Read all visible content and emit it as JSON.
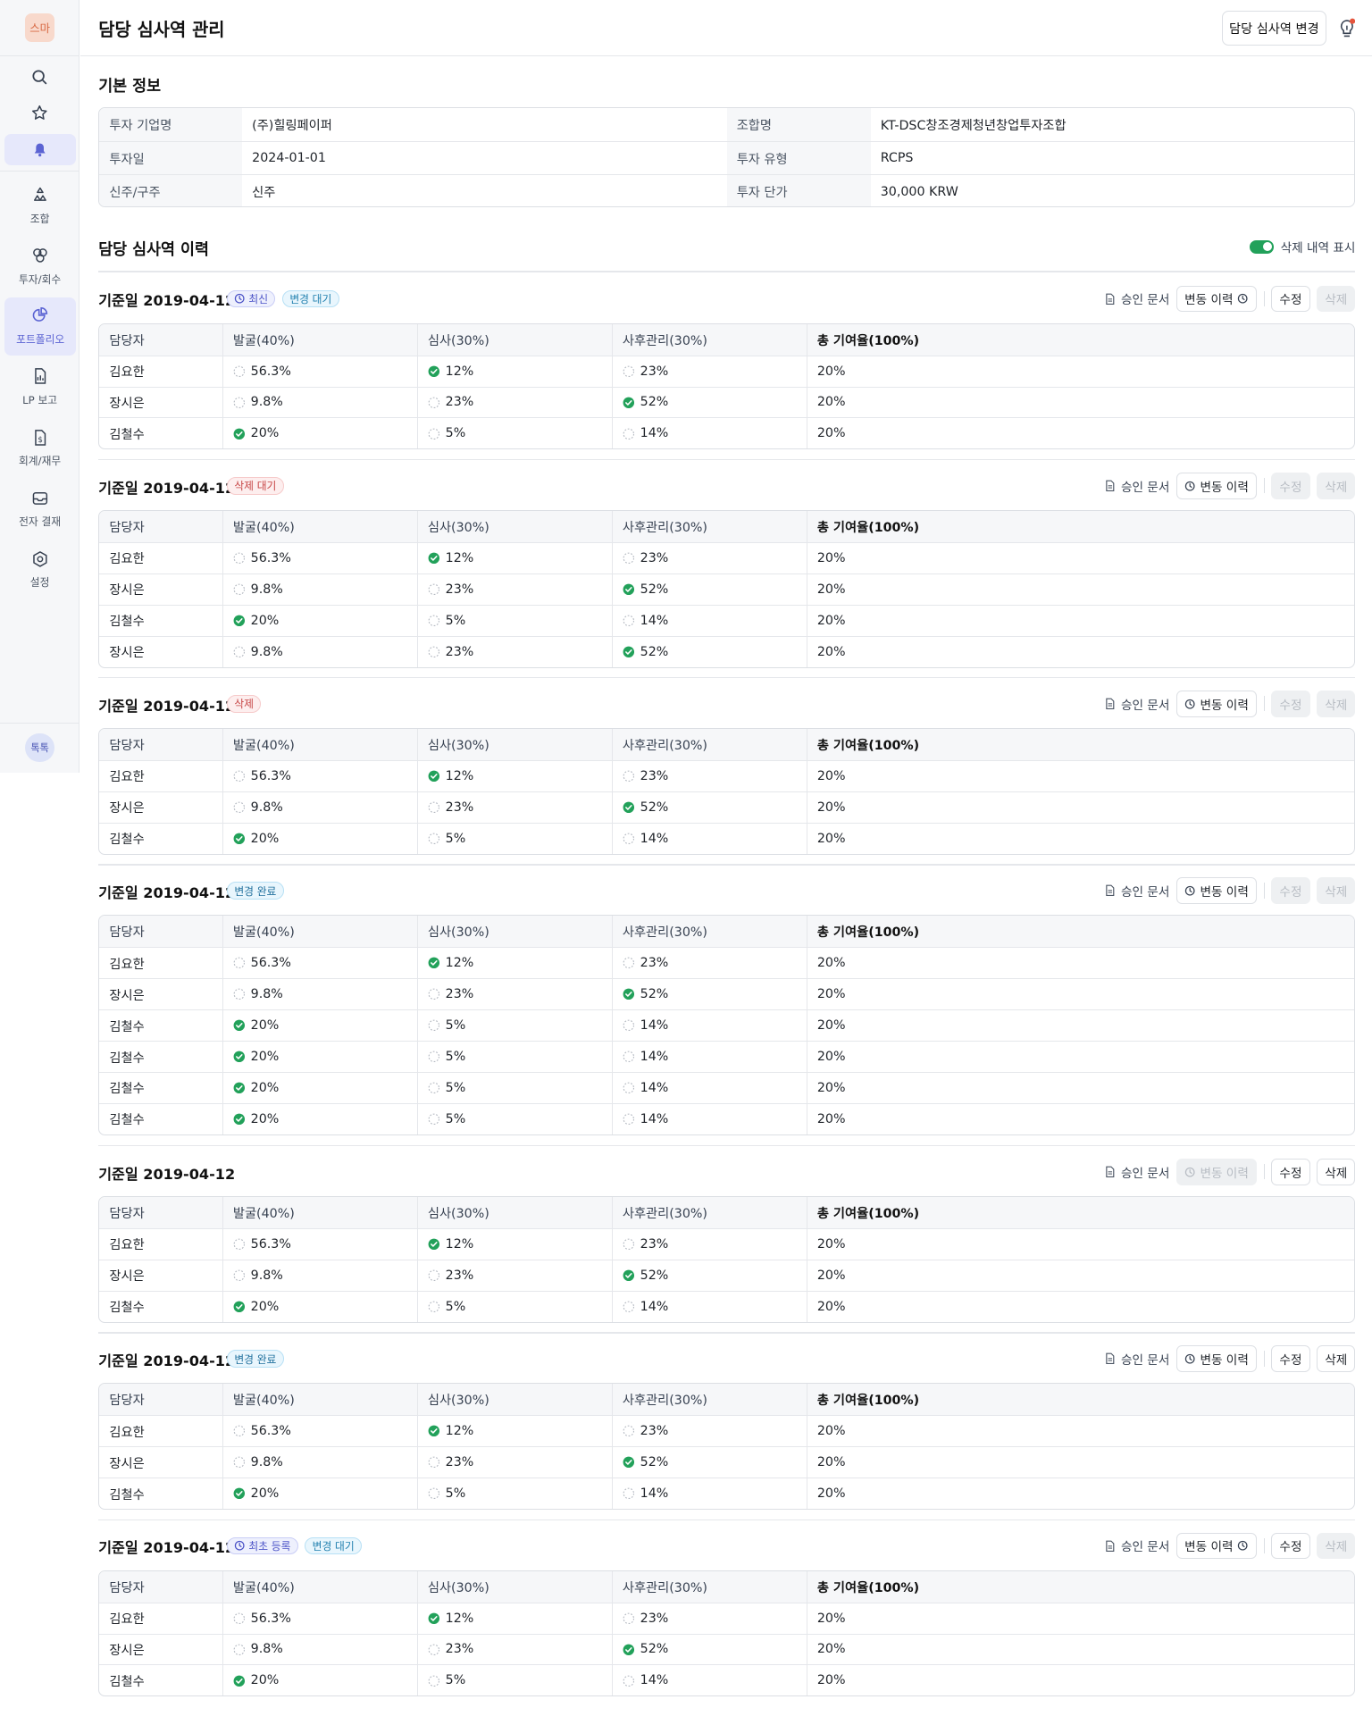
{
  "sidebar": {
    "logo": "스마",
    "talk": "톡톡",
    "items": [
      {
        "label": "조합"
      },
      {
        "label": "투자/회수"
      },
      {
        "label": "포트폴리오"
      },
      {
        "label": "LP 보고"
      },
      {
        "label": "회계/재무"
      },
      {
        "label": "전자 결재"
      },
      {
        "label": "설정"
      }
    ]
  },
  "header": {
    "title": "담당 심사역 관리",
    "change_button": "담당 심사역 변경"
  },
  "basic_info": {
    "title": "기본 정보",
    "rows": [
      [
        {
          "k": "투자 기업명",
          "v": "(주)힐링페이퍼"
        },
        {
          "k": "조합명",
          "v": "KT-DSC창조경제청년창업투자조합"
        }
      ],
      [
        {
          "k": "투자일",
          "v": "2024-01-01"
        },
        {
          "k": "투자 유형",
          "v": "RCPS"
        }
      ],
      [
        {
          "k": "신주/구주",
          "v": "신주"
        },
        {
          "k": "투자 단가",
          "v": "30,000 KRW"
        }
      ]
    ]
  },
  "history": {
    "title": "담당 심사역 이력",
    "toggle_label": "삭제 내역 표시",
    "actions": {
      "doc": "승인 문서",
      "history": "변동 이력",
      "edit": "수정",
      "delete": "삭제"
    },
    "columns": [
      "담당자",
      "발굴(40%)",
      "심사(30%)",
      "사후관리(30%)",
      "총 기여율(100%)"
    ],
    "blocks": [
      {
        "title": "기준일 2019-04-12",
        "badges": [
          {
            "text": "최신",
            "type": "latest",
            "icon": "clock-icon"
          },
          {
            "text": "변경 대기",
            "type": "pending"
          }
        ],
        "rows": [
          [
            "김요한",
            "56.3%",
            "12%",
            "23%",
            "20%"
          ],
          [
            "장시은",
            "9.8%",
            "23%",
            "52%",
            "20%"
          ],
          [
            "김철수",
            "20%",
            "5%",
            "14%",
            "20%"
          ]
        ]
      },
      {
        "title": "기준일 2019-04-12",
        "badges": [
          {
            "text": "삭제 대기",
            "type": "delpending"
          }
        ],
        "rows": [
          [
            "김요한",
            "56.3%",
            "12%",
            "23%",
            "20%"
          ],
          [
            "장시은",
            "9.8%",
            "23%",
            "52%",
            "20%"
          ],
          [
            "김철수",
            "20%",
            "5%",
            "14%",
            "20%"
          ],
          [
            "장시은",
            "9.8%",
            "23%",
            "52%",
            "20%"
          ]
        ]
      },
      {
        "title": "기준일 2019-04-12",
        "badges": [
          {
            "text": "삭제",
            "type": "deleted"
          }
        ],
        "rows": [
          [
            "김요한",
            "56.3%",
            "12%",
            "23%",
            "20%"
          ],
          [
            "장시은",
            "9.8%",
            "23%",
            "52%",
            "20%"
          ],
          [
            "김철수",
            "20%",
            "5%",
            "14%",
            "20%"
          ]
        ]
      },
      {
        "title": "기준일 2019-04-12",
        "badges": [
          {
            "text": "변경 완료",
            "type": "done"
          }
        ],
        "rows": [
          [
            "김요한",
            "56.3%",
            "12%",
            "23%",
            "20%"
          ],
          [
            "장시은",
            "9.8%",
            "23%",
            "52%",
            "20%"
          ],
          [
            "김철수",
            "20%",
            "5%",
            "14%",
            "20%"
          ],
          [
            "김철수",
            "20%",
            "5%",
            "14%",
            "20%"
          ],
          [
            "김철수",
            "20%",
            "5%",
            "14%",
            "20%"
          ],
          [
            "김철수",
            "20%",
            "5%",
            "14%",
            "20%"
          ]
        ]
      },
      {
        "title": "기준일 2019-04-12",
        "badges": [],
        "rows": [
          [
            "김요한",
            "56.3%",
            "12%",
            "23%",
            "20%"
          ],
          [
            "장시은",
            "9.8%",
            "23%",
            "52%",
            "20%"
          ],
          [
            "김철수",
            "20%",
            "5%",
            "14%",
            "20%"
          ]
        ]
      },
      {
        "title": "기준일 2019-04-12",
        "badges": [
          {
            "text": "변경 완료",
            "type": "done"
          }
        ],
        "rows": [
          [
            "김요한",
            "56.3%",
            "12%",
            "23%",
            "20%"
          ],
          [
            "장시은",
            "9.8%",
            "23%",
            "52%",
            "20%"
          ],
          [
            "김철수",
            "20%",
            "5%",
            "14%",
            "20%"
          ]
        ]
      },
      {
        "title": "기준일 2019-04-12",
        "badges": [
          {
            "text": "최초 등록",
            "type": "first",
            "icon": "clock-icon"
          },
          {
            "text": "변경 대기",
            "type": "pending"
          }
        ],
        "rows": [
          [
            "김요한",
            "56.3%",
            "12%",
            "23%",
            "20%"
          ],
          [
            "장시은",
            "9.8%",
            "23%",
            "52%",
            "20%"
          ],
          [
            "김철수",
            "20%",
            "5%",
            "14%",
            "20%"
          ]
        ]
      }
    ]
  },
  "colors": {
    "accent": "#5b63d3",
    "success": "#22a15a",
    "danger": "#c64444",
    "border": "#dcdfe4"
  }
}
